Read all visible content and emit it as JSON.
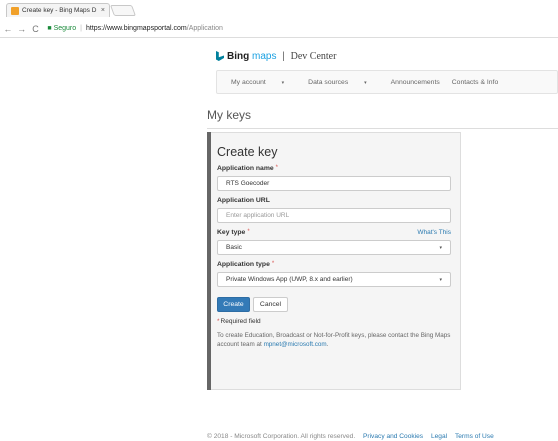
{
  "browser": {
    "tab_title": "Create key - Bing Maps D",
    "tab_close": "×",
    "back": "←",
    "forward": "→",
    "reload": "C",
    "secure_label": "Seguro",
    "url_host": "https://www.bingmapsportal.com",
    "url_path": "/Application"
  },
  "header": {
    "brand_bing": "Bing",
    "brand_maps": "maps",
    "brand_sep": "|",
    "brand_dev": "Dev Center"
  },
  "nav": {
    "items": [
      "My account",
      "Data sources",
      "Announcements",
      "Contacts & Info"
    ],
    "caret": "▾"
  },
  "page": {
    "title": "My keys"
  },
  "form": {
    "title": "Create key",
    "required_mark": "*",
    "app_name_label": "Application name",
    "app_name_value": "RTS Goecoder",
    "app_url_label": "Application URL",
    "app_url_placeholder": "Enter application URL",
    "key_type_label": "Key type",
    "whats_this": "What's This",
    "key_type_value": "Basic",
    "app_type_label": "Application type",
    "app_type_value": "Private Windows App (UWP, 8.x and earlier)",
    "select_arrow": "▾",
    "create_button": "Create",
    "cancel_button": "Cancel",
    "required_field_note": "Required field",
    "info_text_1": "To create Education, Broadcast or Not-for-Profit keys, please contact the Bing Maps account team at",
    "info_email": "mpnet@microsoft.com",
    "info_text_2": "."
  },
  "footer": {
    "copyright": "© 2018 - Microsoft Corporation. All rights reserved.",
    "links": [
      "Privacy and Cookies",
      "Legal",
      "Terms of Use"
    ]
  },
  "colors": {
    "primary_button": "#337ab7",
    "link": "#2a7ab0",
    "required": "#d9534f",
    "bing_teal": "#00809d"
  }
}
